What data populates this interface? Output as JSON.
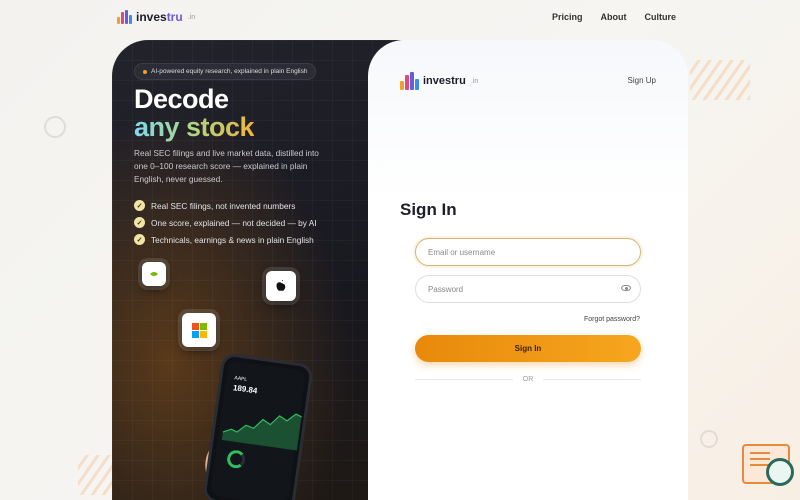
{
  "brand": {
    "name_prefix": "inves",
    "name_suffix": "tru",
    "tld": ".in",
    "bar_colors": [
      "#f0a030",
      "#e04a7a",
      "#6a5cd8",
      "#3a8ee8"
    ]
  },
  "topnav": {
    "links": [
      {
        "label": "Pricing"
      },
      {
        "label": "About"
      },
      {
        "label": "Culture"
      }
    ]
  },
  "hero": {
    "pill": "AI-powered equity research, explained in plain English",
    "headline_line1": "Decode",
    "headline_line2": "any stock",
    "description": "Real SEC filings and live market data, distilled into one 0–100 research score — explained in plain English, never guessed.",
    "features": [
      "Real SEC filings, not invented numbers",
      "One score, explained — not decided — by AI",
      "Technicals, earnings & news in plain English"
    ],
    "check_glyph": "✓",
    "logo_tiles": [
      "nvidia-icon",
      "apple-icon",
      "microsoft-icon"
    ],
    "phone": {
      "ticker": "AAPL",
      "price": "189.84"
    }
  },
  "signin": {
    "signup_label": "Sign Up",
    "title": "Sign In",
    "username_placeholder": "Email or username",
    "password_placeholder": "Password",
    "forgot_label": "Forgot password?",
    "submit_label": "Sign In",
    "divider_label": "OR"
  },
  "colors": {
    "accent": "#f0a030",
    "hero_bg": "#1b1b22",
    "button_gradient_start": "#e8890c",
    "button_gradient_end": "#f6a61e"
  }
}
